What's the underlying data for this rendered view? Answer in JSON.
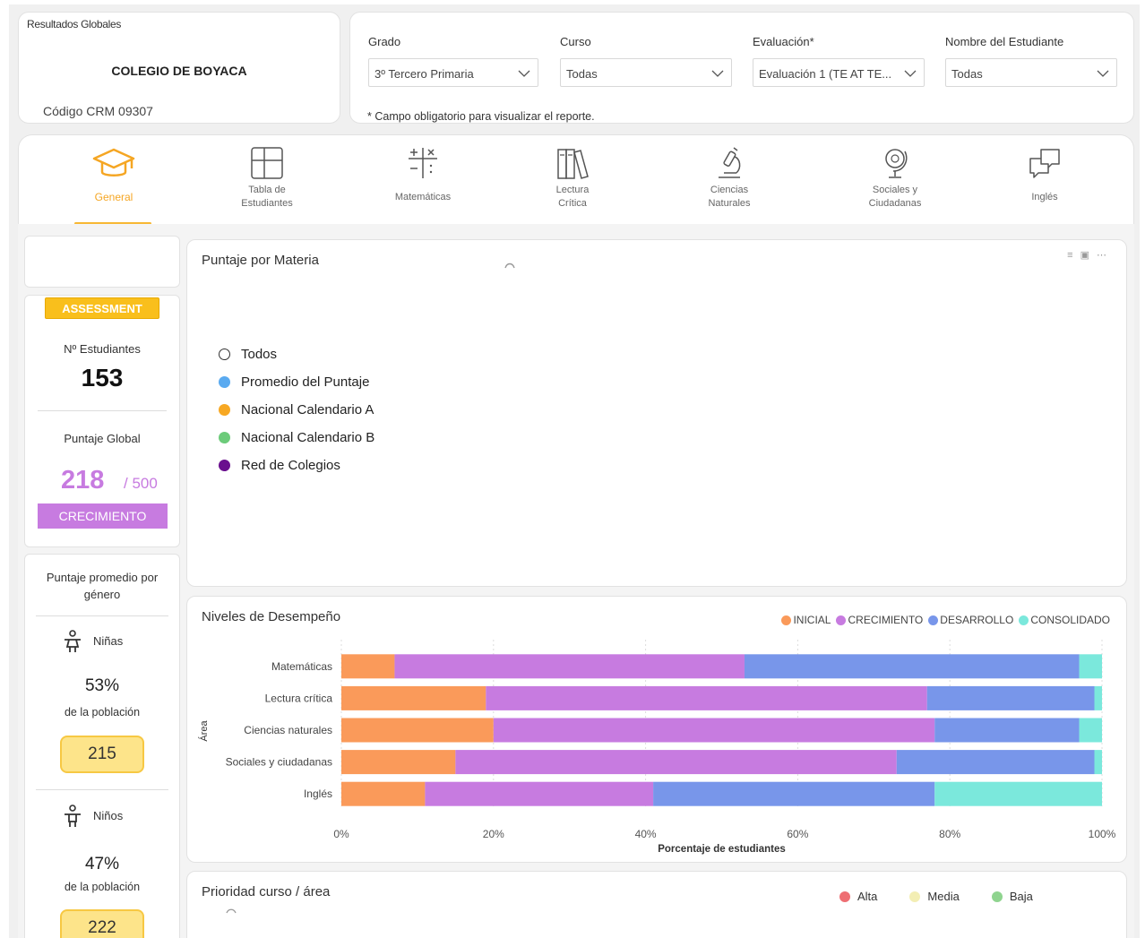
{
  "header": {
    "report_title": "Resultados Globales",
    "school_name": "COLEGIO DE BOYACA",
    "code": "Código CRM 09307",
    "filters": [
      {
        "label": "Grado",
        "value": "3º Tercero Primaria"
      },
      {
        "label": "Curso",
        "value": "Todas"
      },
      {
        "label": "Evaluación*",
        "value": "Evaluación 1 (TE AT TE..."
      },
      {
        "label": "Nombre del Estudiante",
        "value": "Todas"
      }
    ],
    "note": "* Campo obligatorio para visualizar el reporte."
  },
  "tabs": [
    {
      "label": "General",
      "icon": "graduation-cap-icon",
      "active": true
    },
    {
      "label": "Tabla de Estudiantes",
      "icon": "table-icon"
    },
    {
      "label": "Matemáticas",
      "icon": "math-operators-icon"
    },
    {
      "label": "Lectura Crítica",
      "icon": "books-icon"
    },
    {
      "label": "Ciencias Naturales",
      "icon": "microscope-icon"
    },
    {
      "label": "Sociales y Ciudadanas",
      "icon": "globe-icon"
    },
    {
      "label": "Inglés",
      "icon": "chat-bubbles-icon"
    }
  ],
  "assessment": {
    "badge": "ASSESSMENT",
    "students_label": "Nº Estudiantes",
    "students_count": "153",
    "global_label": "Puntaje Global",
    "global_score": "218",
    "global_max": "/ 500",
    "level": "CRECIMIENTO",
    "level_color": "#c77be0"
  },
  "gender": {
    "title": "Puntaje promedio por género",
    "groups": [
      {
        "label": "Niñas",
        "percent": "53%",
        "pop_label": "de la población",
        "score": "215"
      },
      {
        "label": "Niños",
        "percent": "47%",
        "pop_label": "de la población",
        "score": "222"
      }
    ]
  },
  "puntaje_materia": {
    "title": "Puntaje por Materia",
    "controls": "filter-icon expand-icon more-icon",
    "legend": [
      {
        "label": "Todos",
        "color": "#ffffff"
      },
      {
        "label": "Promedio del Puntaje",
        "color": "#5aaaf0"
      },
      {
        "label": "Nacional Calendario A",
        "color": "#f7a823"
      },
      {
        "label": "Nacional Calendario B",
        "color": "#6ccb7a"
      },
      {
        "label": "Red de Colegios",
        "color": "#6a0f8e"
      }
    ]
  },
  "niveles": {
    "title": "Niveles de Desempeño"
  },
  "chart_data": {
    "type": "bar",
    "orientation": "horizontal",
    "stacked": true,
    "title": "Niveles de Desempeño",
    "xlabel": "Porcentaje de estudiantes",
    "ylabel": "Área",
    "categories": [
      "Matemáticas",
      "Lectura crítica",
      "Ciencias naturales",
      "Sociales y ciudadanas",
      "Inglés"
    ],
    "series": [
      {
        "name": "INICIAL",
        "color": "#fa9a5a",
        "values": [
          7,
          19,
          20,
          15,
          11
        ]
      },
      {
        "name": "CRECIMIENTO",
        "color": "#c77be0",
        "values": [
          46,
          58,
          58,
          58,
          30
        ]
      },
      {
        "name": "DESARROLLO",
        "color": "#7896ea",
        "values": [
          44,
          22,
          19,
          26,
          37
        ]
      },
      {
        "name": "CONSOLIDADO",
        "color": "#7be8dc",
        "values": [
          3,
          1,
          3,
          1,
          22
        ]
      }
    ],
    "xticks": [
      "0%",
      "20%",
      "40%",
      "60%",
      "80%",
      "100%"
    ],
    "xlim": [
      0,
      100
    ],
    "grid": true,
    "legend_position": "top-right"
  },
  "prioridad": {
    "title": "Prioridad curso / área",
    "legend": [
      {
        "label": "Alta",
        "color": "#ee6e73"
      },
      {
        "label": "Media",
        "color": "#f3eeb4"
      },
      {
        "label": "Baja",
        "color": "#8fd48f"
      }
    ]
  }
}
